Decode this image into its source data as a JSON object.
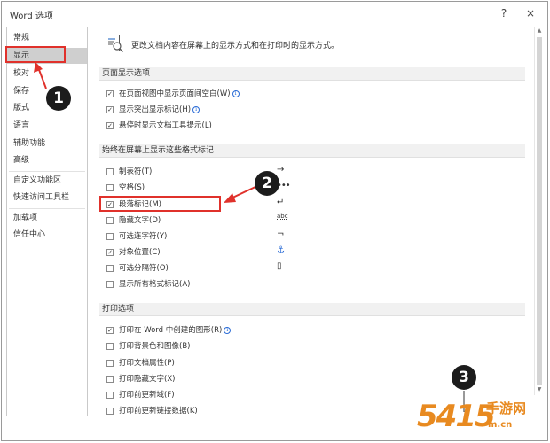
{
  "window": {
    "title": "Word 选项",
    "help_label": "?",
    "close_label": "×"
  },
  "sidebar": {
    "items": [
      {
        "label": "常规"
      },
      {
        "label": "显示",
        "selected": true
      },
      {
        "label": "校对"
      },
      {
        "label": "保存"
      },
      {
        "label": "版式"
      },
      {
        "label": "语言"
      },
      {
        "label": "辅助功能"
      },
      {
        "label": "高级"
      },
      {
        "label": "自定义功能区"
      },
      {
        "label": "快速访问工具栏"
      },
      {
        "label": "加载项"
      },
      {
        "label": "信任中心"
      }
    ]
  },
  "header": {
    "description": "更改文档内容在屏幕上的显示方式和在打印时的显示方式。",
    "icon": "display-settings-icon"
  },
  "sections": {
    "page_display": {
      "title": "页面显示选项",
      "options": [
        {
          "label": "在页面视图中显示页面间空白(W)",
          "checked": true,
          "info": true
        },
        {
          "label": "显示突出显示标记(H)",
          "checked": true,
          "info": true
        },
        {
          "label": "悬停时显示文档工具提示(L)",
          "checked": true,
          "info": false
        }
      ]
    },
    "formatting_marks": {
      "title": "始终在屏幕上显示这些格式标记",
      "options": [
        {
          "label": "制表符(T)",
          "checked": false,
          "symbol": "→"
        },
        {
          "label": "空格(S)",
          "checked": false,
          "symbol": "•••"
        },
        {
          "label": "段落标记(M)",
          "checked": true,
          "symbol": "↵"
        },
        {
          "label": "隐藏文字(D)",
          "checked": false,
          "symbol": "abc"
        },
        {
          "label": "可选连字符(Y)",
          "checked": false,
          "symbol": "¬"
        },
        {
          "label": "对象位置(C)",
          "checked": true,
          "symbol": "⚓"
        },
        {
          "label": "可选分隔符(O)",
          "checked": false,
          "symbol": "▯"
        },
        {
          "label": "显示所有格式标记(A)",
          "checked": false,
          "symbol": ""
        }
      ]
    },
    "print": {
      "title": "打印选项",
      "options": [
        {
          "label": "打印在 Word 中创建的图形(R)",
          "checked": true,
          "info": true
        },
        {
          "label": "打印背景色和图像(B)",
          "checked": false,
          "info": false
        },
        {
          "label": "打印文档属性(P)",
          "checked": false,
          "info": false
        },
        {
          "label": "打印隐藏文字(X)",
          "checked": false,
          "info": false
        },
        {
          "label": "打印前更新域(F)",
          "checked": false,
          "info": false
        },
        {
          "label": "打印前更新链接数据(K)",
          "checked": false,
          "info": false
        }
      ]
    }
  },
  "annotations": {
    "badges": [
      "1",
      "2",
      "3"
    ],
    "highlight_color": "#e0312b"
  },
  "watermark": {
    "brand": "手游网",
    "url": "m.cn"
  },
  "colors": {
    "selected_bg": "#cfcfcf",
    "section_bg": "#f1f1f1",
    "info_blue": "#2b6cd6",
    "anchor_blue": "#2b6cd6",
    "watermark_orange": "#e88a20"
  }
}
